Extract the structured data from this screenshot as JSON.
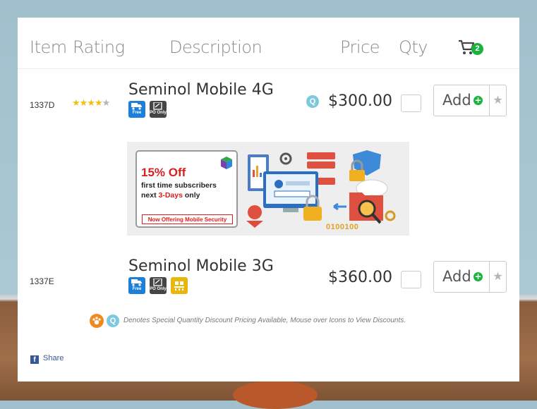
{
  "header": {
    "col_item": "Item",
    "col_rating": "Rating",
    "col_description": "Description",
    "col_price": "Price",
    "col_qty": "Qty",
    "cart_count": "2"
  },
  "products": [
    {
      "sku": "1337D",
      "rating": 4,
      "rating_max": 5,
      "name": "Seminol Mobile 4G",
      "badges": [
        "Free",
        "PO Only"
      ],
      "price": "$300.00",
      "add_label": "Add"
    },
    {
      "sku": "1337E",
      "name": "Seminol Mobile 3G",
      "badges": [
        "Free",
        "PO Only",
        ""
      ],
      "price": "$360.00",
      "add_label": "Add"
    }
  ],
  "banner": {
    "title": "15% Off",
    "line1": "first time subscribers",
    "line2_prefix": "next ",
    "line2_highlight": "3-Days",
    "line2_suffix": " only",
    "tag": "Now Offering Mobile Security",
    "binary": "0100100"
  },
  "footer_note": "Denotes Special Quantity Discount Pricing Available, Mouse over Icons to View Discounts.",
  "share_label": "Share",
  "colors": {
    "accent_green": "#19b23c",
    "star": "#f2c014",
    "promo_red": "#d92020",
    "free_blue": "#1c7fd9"
  }
}
